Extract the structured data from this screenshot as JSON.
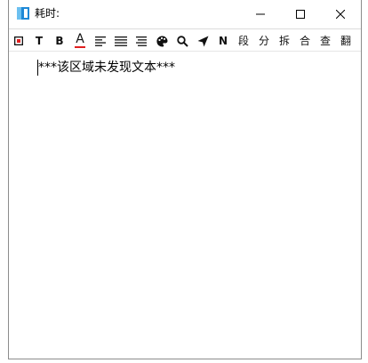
{
  "window": {
    "title": "耗时:",
    "controls": {
      "minimize": "minimize",
      "maximize": "maximize",
      "close": "close"
    }
  },
  "toolbar": {
    "items": [
      {
        "icon": "stop-square-icon",
        "label": ""
      },
      {
        "icon": "text-t-icon",
        "label": "T"
      },
      {
        "icon": "bold-b-icon",
        "label": "B"
      },
      {
        "icon": "font-color-icon",
        "label": "A",
        "accent": "#e02020"
      },
      {
        "icon": "align-left-icon",
        "label": ""
      },
      {
        "icon": "align-justify-icon",
        "label": ""
      },
      {
        "icon": "align-right-icon",
        "label": ""
      },
      {
        "icon": "palette-icon",
        "label": ""
      },
      {
        "icon": "search-icon",
        "label": ""
      },
      {
        "icon": "send-icon",
        "label": ""
      },
      {
        "icon": "n-icon",
        "label": "N"
      },
      {
        "icon": "paragraph-icon",
        "label": "段"
      },
      {
        "icon": "split-icon",
        "label": "分"
      },
      {
        "icon": "unsplit-icon",
        "label": "拆"
      },
      {
        "icon": "merge-icon",
        "label": "合"
      },
      {
        "icon": "lookup-icon",
        "label": "查"
      },
      {
        "icon": "translate-icon",
        "label": "翻"
      }
    ]
  },
  "editor": {
    "content": "***该区域未发现文本***"
  },
  "colors": {
    "app_icon_blue": "#1e88d6",
    "border": "#8c8c8c",
    "font_color_underline": "#e02020"
  }
}
